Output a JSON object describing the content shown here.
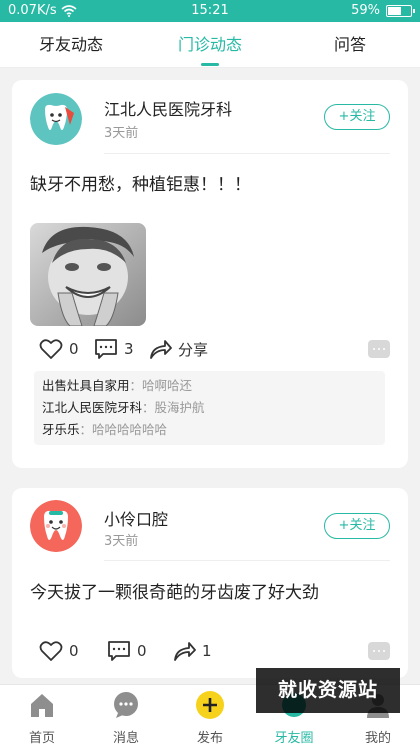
{
  "status_bar": {
    "speed": "0.07K/s",
    "time": "15:21",
    "battery": "59%",
    "battery_level": 0.59
  },
  "tabs": [
    {
      "label": "牙友动态",
      "active": false
    },
    {
      "label": "门诊动态",
      "active": true
    },
    {
      "label": "问答",
      "active": false
    }
  ],
  "posts": [
    {
      "author": "江北人民医院牙科",
      "time": "3天前",
      "follow_label": "+关注",
      "content": "缺牙不用愁，种植钜惠！！！",
      "likes": "0",
      "comments_count": "3",
      "share_label": "分享",
      "comments": [
        {
          "name": "出售灶具自家用",
          "sep": "：",
          "text": "哈啊哈还"
        },
        {
          "name": "江北人民医院牙科",
          "sep": "：",
          "text": "股海护航"
        },
        {
          "name": "牙乐乐",
          "sep": "：",
          "text": "哈哈哈哈哈哈"
        }
      ]
    },
    {
      "author": "小伶口腔",
      "time": "3天前",
      "follow_label": "+关注",
      "content": "今天拔了一颗很奇葩的牙齿废了好大劲",
      "likes": "0",
      "comments_count": "0",
      "shares": "1"
    }
  ],
  "nav": [
    {
      "label": "首页",
      "icon": "home-icon"
    },
    {
      "label": "消息",
      "icon": "message-icon"
    },
    {
      "label": "发布",
      "icon": "plus-icon"
    },
    {
      "label": "牙友圈",
      "icon": "circle-icon",
      "active": true
    },
    {
      "label": "我的",
      "icon": "user-icon"
    }
  ],
  "watermark": "就收资源站",
  "colors": {
    "accent": "#27b9a4",
    "publish": "#f7d21c"
  }
}
